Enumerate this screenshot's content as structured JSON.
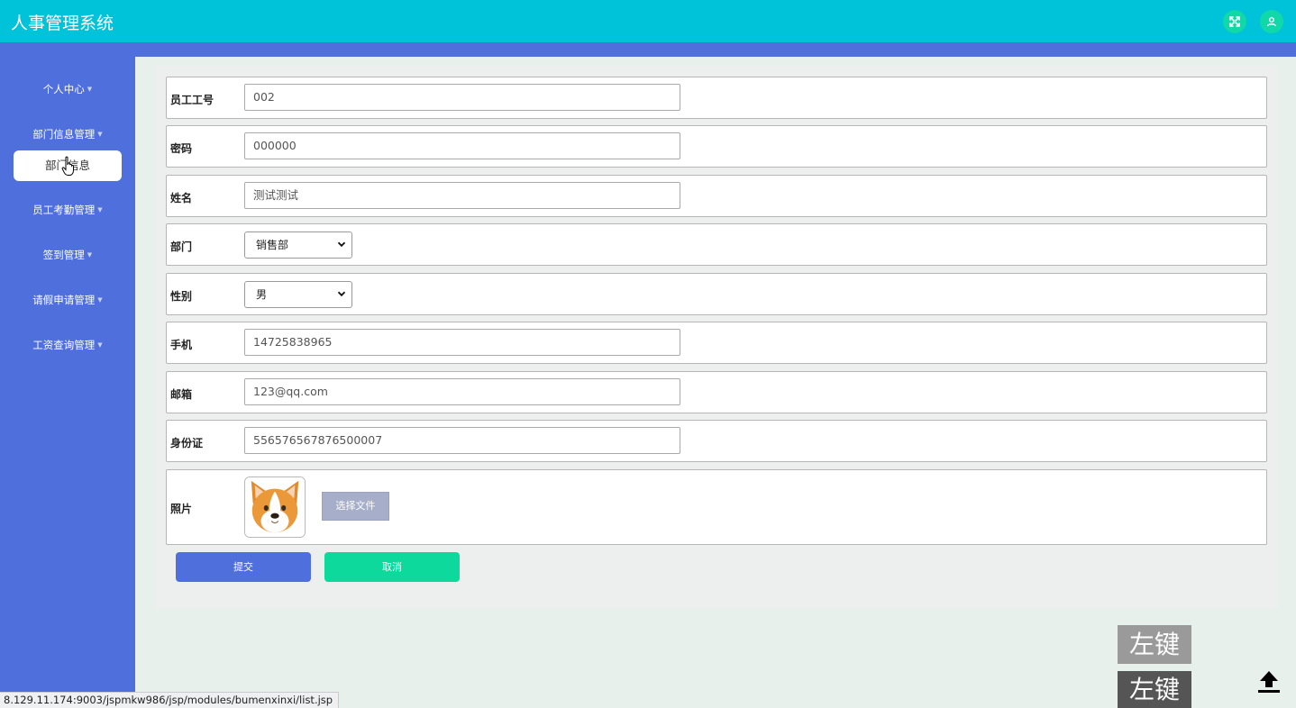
{
  "app": {
    "title": "人事管理系统"
  },
  "header": {
    "fullscreen_icon": "fullscreen-icon",
    "user_icon": "user-icon"
  },
  "sidebar": {
    "items": [
      {
        "label": "个人中心"
      },
      {
        "label": "部门信息管理",
        "expanded": true,
        "children": [
          {
            "label": "部门信息",
            "active": true
          }
        ]
      },
      {
        "label": "员工考勤管理"
      },
      {
        "label": "签到管理"
      },
      {
        "label": "请假申请管理"
      },
      {
        "label": "工资查询管理"
      }
    ]
  },
  "form": {
    "employee_id": {
      "label": "员工工号",
      "value": "002"
    },
    "password": {
      "label": "密码",
      "value": "000000"
    },
    "name": {
      "label": "姓名",
      "value": "测试测试"
    },
    "department": {
      "label": "部门",
      "value": "销售部"
    },
    "gender": {
      "label": "性别",
      "value": "男"
    },
    "phone": {
      "label": "手机",
      "value": "14725838965"
    },
    "email": {
      "label": "邮箱",
      "value": "123@qq.com"
    },
    "id_card": {
      "label": "身份证",
      "value": "556576567876500007"
    },
    "photo": {
      "label": "照片",
      "file_button": "选择文件"
    }
  },
  "actions": {
    "submit": "提交",
    "cancel": "取消"
  },
  "overlay": {
    "left_key_1": "左键",
    "left_key_2": "左键"
  },
  "status_bar": {
    "url": "8.129.11.174:9003/jspmkw986/jsp/modules/bumenxinxi/list.jsp"
  },
  "colors": {
    "header": "#00c2d9",
    "sidebar": "#4f6fdc",
    "submit": "#4f6fdc",
    "cancel": "#0ed99c",
    "header_icon_bg": "#10d8a8"
  }
}
